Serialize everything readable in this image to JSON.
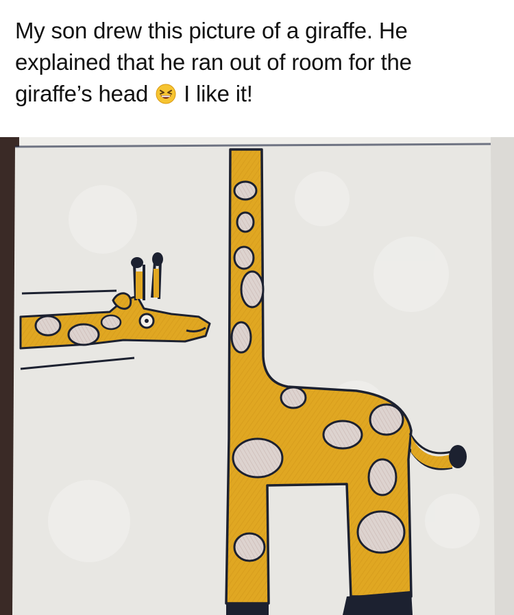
{
  "post": {
    "caption_part1": "My son drew this picture of a giraffe. He explained that he ran out of room for the giraffe’s head",
    "caption_emoji": "grinning-squinting-face-emoji",
    "caption_part2": "I like it!"
  },
  "photo": {
    "subject": "child-drawing-of-giraffe",
    "colors": {
      "paper": "#e9e8e4",
      "giraffe_fill": "#e0a722",
      "outline": "#1c2130",
      "spot_fill": "#d9ccc7",
      "dark_surface": "#2a2020"
    }
  }
}
